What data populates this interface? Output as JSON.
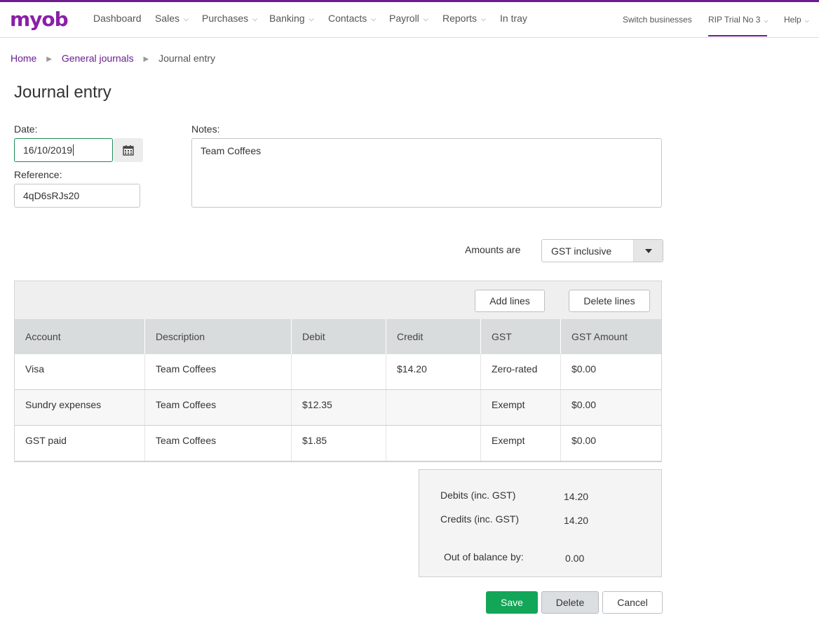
{
  "brand": {
    "logo_text": "myob",
    "accent_color": "#6b1d8f",
    "save_color": "#13a558"
  },
  "nav": {
    "items": [
      {
        "label": "Dashboard",
        "has_dropdown": false
      },
      {
        "label": "Sales",
        "has_dropdown": true
      },
      {
        "label": "Purchases",
        "has_dropdown": true
      },
      {
        "label": "Banking",
        "has_dropdown": true
      },
      {
        "label": "Contacts",
        "has_dropdown": true
      },
      {
        "label": "Payroll",
        "has_dropdown": true
      },
      {
        "label": "Reports",
        "has_dropdown": true
      },
      {
        "label": "In tray",
        "has_dropdown": false
      }
    ],
    "switch_businesses": "Switch businesses",
    "business_name": "RIP Trial No 3",
    "help": "Help"
  },
  "breadcrumb": {
    "home": "Home",
    "general_journals": "General journals",
    "current": "Journal entry"
  },
  "page_title": "Journal entry",
  "form": {
    "date_label": "Date:",
    "date_value": "16/10/2019",
    "reference_label": "Reference:",
    "reference_value": "4qD6sRJs20",
    "notes_label": "Notes:",
    "notes_value": "Team Coffees",
    "amounts_label": "Amounts are",
    "amounts_value": "GST inclusive"
  },
  "table": {
    "add_lines": "Add lines",
    "delete_lines": "Delete lines",
    "columns": [
      "Account",
      "Description",
      "Debit",
      "Credit",
      "GST",
      "GST Amount"
    ],
    "rows": [
      {
        "account": "Visa",
        "description": "Team Coffees",
        "debit": "",
        "credit": "$14.20",
        "gst": "Zero-rated",
        "gst_amount": "$0.00"
      },
      {
        "account": "Sundry expenses",
        "description": "Team Coffees",
        "debit": "$12.35",
        "credit": "",
        "gst": "Exempt",
        "gst_amount": "$0.00"
      },
      {
        "account": "GST paid",
        "description": "Team Coffees",
        "debit": "$1.85",
        "credit": "",
        "gst": "Exempt",
        "gst_amount": "$0.00"
      }
    ]
  },
  "summary": {
    "debits_label": "Debits (inc. GST)",
    "debits_value": "14.20",
    "credits_label": "Credits (inc. GST)",
    "credits_value": "14.20",
    "balance_label": "Out of balance by:",
    "balance_value": "0.00"
  },
  "actions": {
    "save": "Save",
    "delete": "Delete",
    "cancel": "Cancel"
  }
}
